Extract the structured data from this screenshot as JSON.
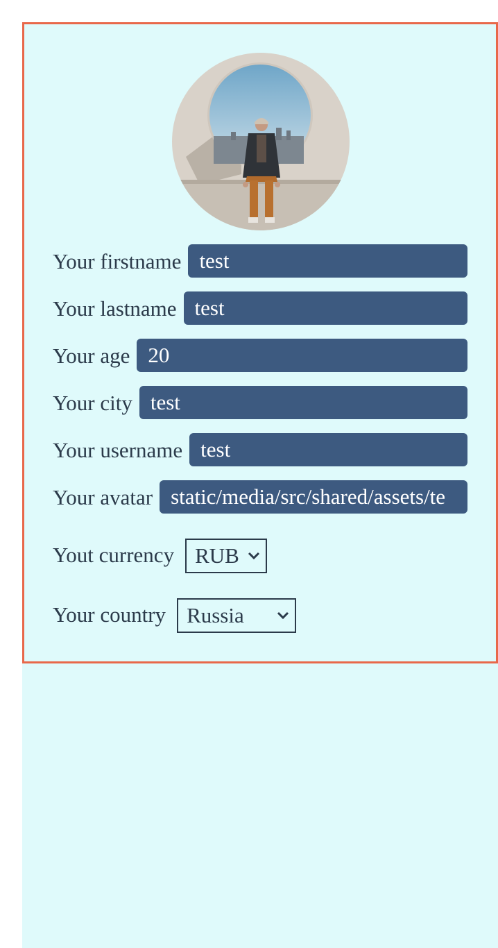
{
  "profile": {
    "avatar_alt": "Your avatar",
    "fields": [
      {
        "label": "Your firstname",
        "value": "test"
      },
      {
        "label": "Your lastname",
        "value": "test"
      },
      {
        "label": "Your age",
        "value": "20"
      },
      {
        "label": "Your city",
        "value": "test"
      },
      {
        "label": "Your username",
        "value": "test"
      },
      {
        "label": "Your avatar",
        "value": "static/media/src/shared/assets/te"
      }
    ],
    "currency": {
      "label": "Yout currency",
      "value": "RUB"
    },
    "country": {
      "label": "Your country",
      "value": "Russia"
    }
  },
  "colors": {
    "card_border": "#e8684a",
    "background": "#dffafb",
    "input_bg": "#3d5a80",
    "text": "#2b3a4a"
  }
}
